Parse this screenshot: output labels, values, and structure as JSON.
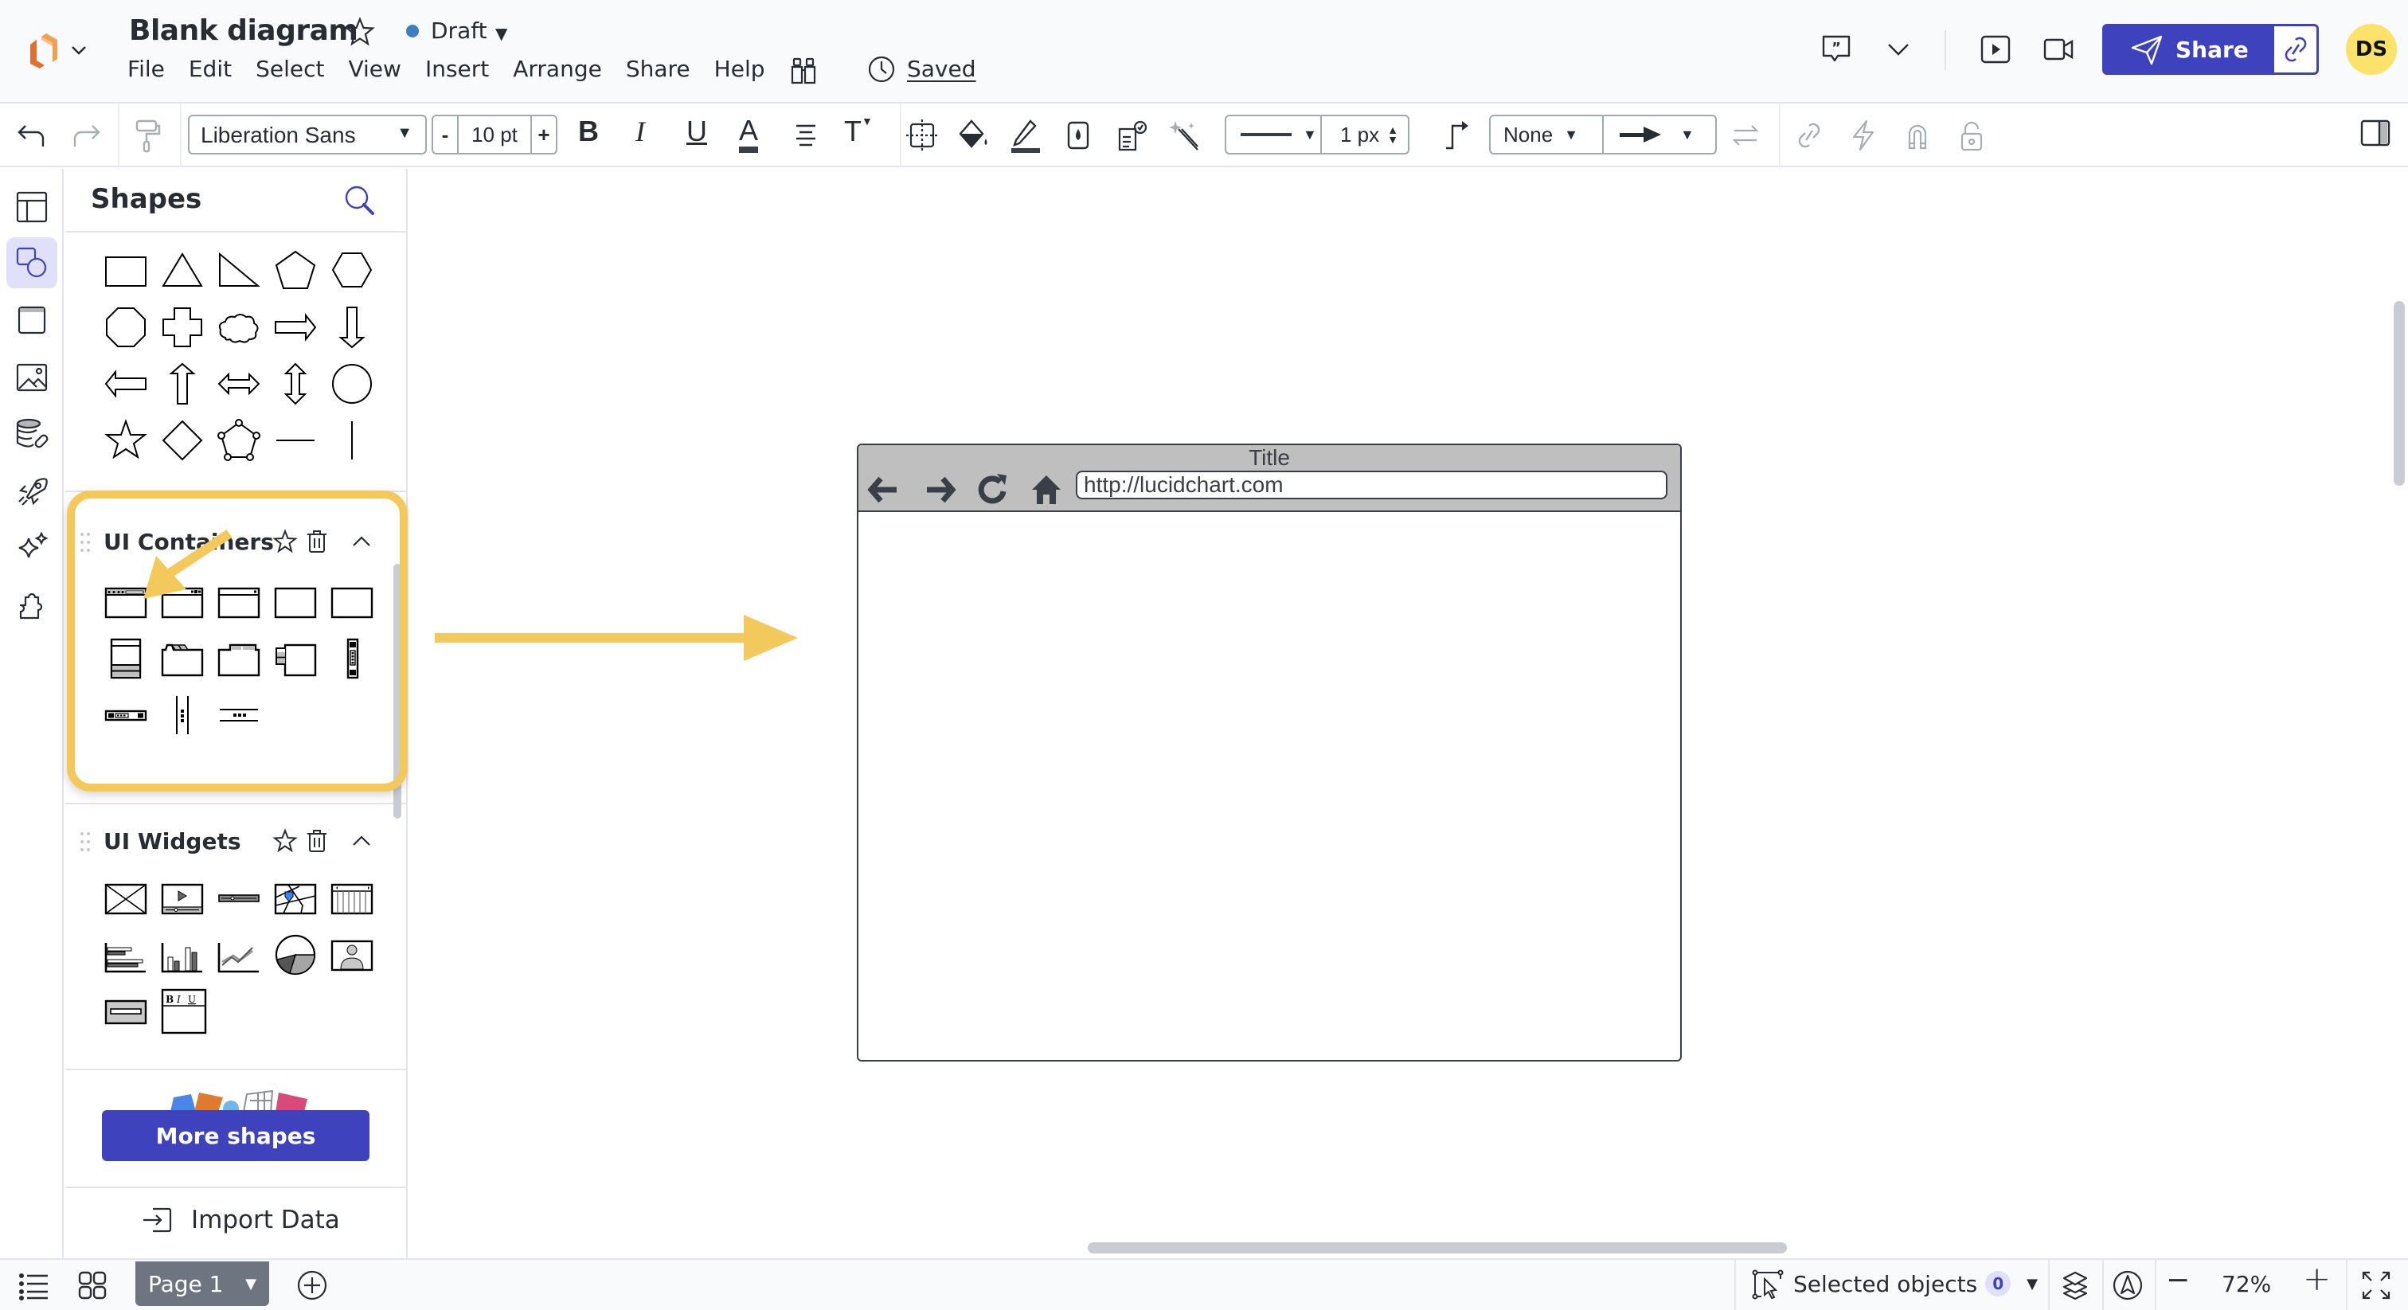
{
  "app": {
    "document_title": "Blank diagram",
    "status": "Draft",
    "status_color": "#3c7fc0",
    "save_status": "Saved",
    "menu": [
      "File",
      "Edit",
      "Select",
      "View",
      "Insert",
      "Arrange",
      "Share",
      "Help"
    ],
    "share_label": "Share",
    "avatar_initials": "DS",
    "accent_color": "#3e43bd",
    "header_icons": [
      "logo-icon",
      "chevron-down-icon",
      "star-icon",
      "find-binoculars-icon",
      "clock-icon",
      "comment-icon",
      "chevron-down-icon",
      "present-icon",
      "video-icon",
      "send-icon",
      "link-icon"
    ]
  },
  "toolbar": {
    "font_family": "Liberation Sans",
    "font_size": "10 pt",
    "size_decrement": "-",
    "size_increment": "+",
    "bold": "B",
    "italic": "I",
    "underline": "U",
    "text_color": "A",
    "text_options": "T",
    "line_width": "1 px",
    "line_start": "None",
    "icons": [
      "undo-icon",
      "redo-icon",
      "format-painter-icon",
      "container-icon",
      "fill-color-icon",
      "line-color-icon",
      "opacity-icon",
      "conditional-format-icon",
      "magic-wand-icon",
      "line-style-icon",
      "connector-style-icon",
      "arrow-end-icon",
      "swap-icon",
      "link-icon",
      "action-icon",
      "magnet-icon",
      "lock-icon",
      "panel-toggle-icon"
    ]
  },
  "rail": {
    "items": [
      "templates-icon",
      "shapes-icon",
      "frames-icon",
      "images-icon",
      "data-link-icon",
      "rocket-icon",
      "ai-sparkle-icon",
      "integrations-icon"
    ],
    "active": "shapes-icon"
  },
  "panel": {
    "title": "Shapes",
    "search_icon": "search-icon",
    "standard_shapes": [
      "rectangle",
      "triangle",
      "right-triangle",
      "pentagon",
      "hexagon",
      "octagon",
      "cross",
      "cloud",
      "arrow-right",
      "arrow-down",
      "arrow-left",
      "arrow-up",
      "arrow-left-right",
      "arrow-up-down",
      "circle",
      "star",
      "diamond",
      "polygon",
      "horizontal-line",
      "vertical-line"
    ],
    "libraries": [
      {
        "title": "UI Containers",
        "shapes": [
          "browser-window",
          "app-window",
          "dialog-window",
          "panel",
          "panel-plain",
          "accordion",
          "tab-folder",
          "tabs-bar",
          "vertical-tabs",
          "vertical-scrollbar",
          "horizontal-scrollbar",
          "vertical-splitter",
          "horizontal-splitter"
        ]
      },
      {
        "title": "UI Widgets",
        "shapes": [
          "image-placeholder",
          "video-player",
          "slider",
          "map",
          "calendar",
          "bar-chart-horizontal",
          "bar-chart",
          "line-chart",
          "pie-chart",
          "user-image",
          "text-field-box",
          "rich-text-editor"
        ]
      }
    ],
    "more_shapes_label": "More shapes",
    "import_data_label": "Import Data"
  },
  "canvas": {
    "browser_shape": {
      "title": "Title",
      "url": "http://lucidchart.com",
      "nav_icons": [
        "back-arrow-icon",
        "forward-arrow-icon",
        "reload-icon",
        "home-icon"
      ]
    },
    "annotation_color": "#f4c95c"
  },
  "bottom": {
    "page_label": "Page 1",
    "selected_objects_label": "Selected objects",
    "selected_count": "0",
    "zoom_level": "72%",
    "zoom_out": "−",
    "zoom_in": "+"
  }
}
